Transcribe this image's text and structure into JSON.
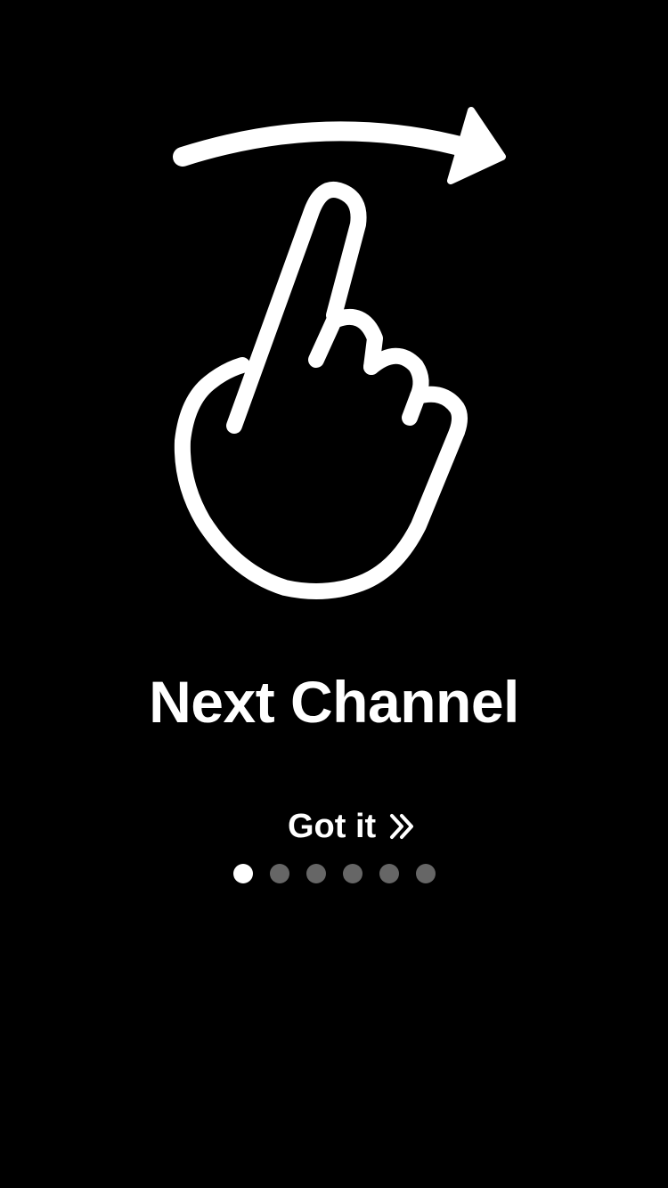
{
  "onboarding": {
    "title": "Next Channel",
    "action_label": "Got it",
    "action_icon": "double-chevron-right-icon",
    "illustration_icon": "swipe-right-hand-icon",
    "page_indicator": {
      "total": 6,
      "current": 1
    }
  },
  "colors": {
    "background": "#000000",
    "foreground": "#ffffff",
    "dot_inactive": "#666666",
    "dot_active": "#ffffff"
  }
}
